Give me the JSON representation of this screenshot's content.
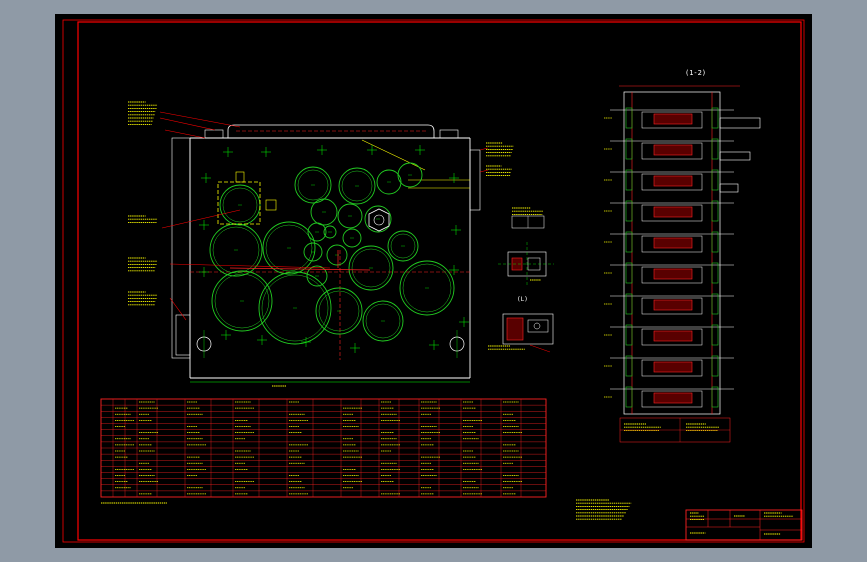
{
  "drawing": {
    "section_label": "(1-2)",
    "detail_label": "(L)",
    "colors": {
      "background": "#000000",
      "frame": "#ff0000",
      "geometry": "#ffffff",
      "circles": "#22cc22",
      "centerlines": "#00ff00",
      "leaders": "#ff0000",
      "dimensions": "#00ff00",
      "hatch": "#ff2222",
      "highlight": "#ffff00"
    }
  }
}
